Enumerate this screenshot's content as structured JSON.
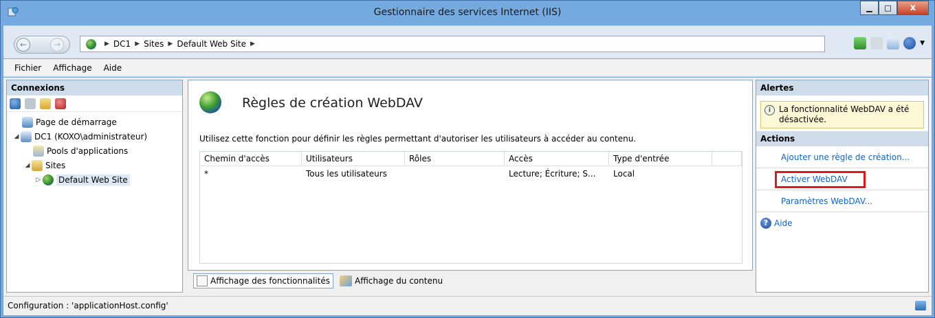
{
  "window": {
    "title": "Gestionnaire des services Internet (IIS)",
    "buttons": {
      "minimize": "▁",
      "maximize": "□",
      "close": "x"
    }
  },
  "address": {
    "breadcrumbs": [
      "DC1",
      "Sites",
      "Default Web Site"
    ]
  },
  "menu": [
    "Fichier",
    "Affichage",
    "Aide"
  ],
  "connections": {
    "title": "Connexions",
    "tree": [
      {
        "label": "Page de démarrage",
        "level": 0,
        "icon": "start-page-icon"
      },
      {
        "label": "DC1 (KOXO\\administrateur)",
        "level": 0,
        "icon": "server-icon",
        "expanded": true
      },
      {
        "label": "Pools d'applications",
        "level": 1,
        "icon": "app-pool-icon"
      },
      {
        "label": "Sites",
        "level": 1,
        "icon": "sites-folder-icon",
        "expanded": true
      },
      {
        "label": "Default Web Site",
        "level": 2,
        "icon": "globe-icon",
        "selected": true
      }
    ]
  },
  "feature": {
    "title": "Règles de création WebDAV",
    "description": "Utilisez cette fonction pour définir les règles permettant d'autoriser les utilisateurs à accéder au contenu.",
    "columns": [
      "Chemin d'accès",
      "Utilisateurs",
      "Rôles",
      "Accès",
      "Type d'entrée"
    ],
    "rows": [
      [
        "*",
        "Tous les utilisateurs",
        "",
        "Lecture; Écriture; S...",
        "Local"
      ]
    ]
  },
  "view_tabs": {
    "features": "Affichage des fonctionnalités",
    "content": "Affichage du contenu"
  },
  "right_panel": {
    "alerts_title": "Alertes",
    "alert_text": "La fonctionnalité WebDAV a été désactivée.",
    "actions_title": "Actions",
    "actions": {
      "add_rule": "Ajouter une règle de création...",
      "enable": "Activer WebDAV",
      "settings": "Paramètres WebDAV...",
      "help": "Aide"
    }
  },
  "status": {
    "text": "Configuration : 'applicationHost.config'"
  },
  "colors": {
    "window_frame": "#75a9dd",
    "link": "#1064c4",
    "highlight_border": "#e01818",
    "panel_header": "#cfdcea"
  }
}
